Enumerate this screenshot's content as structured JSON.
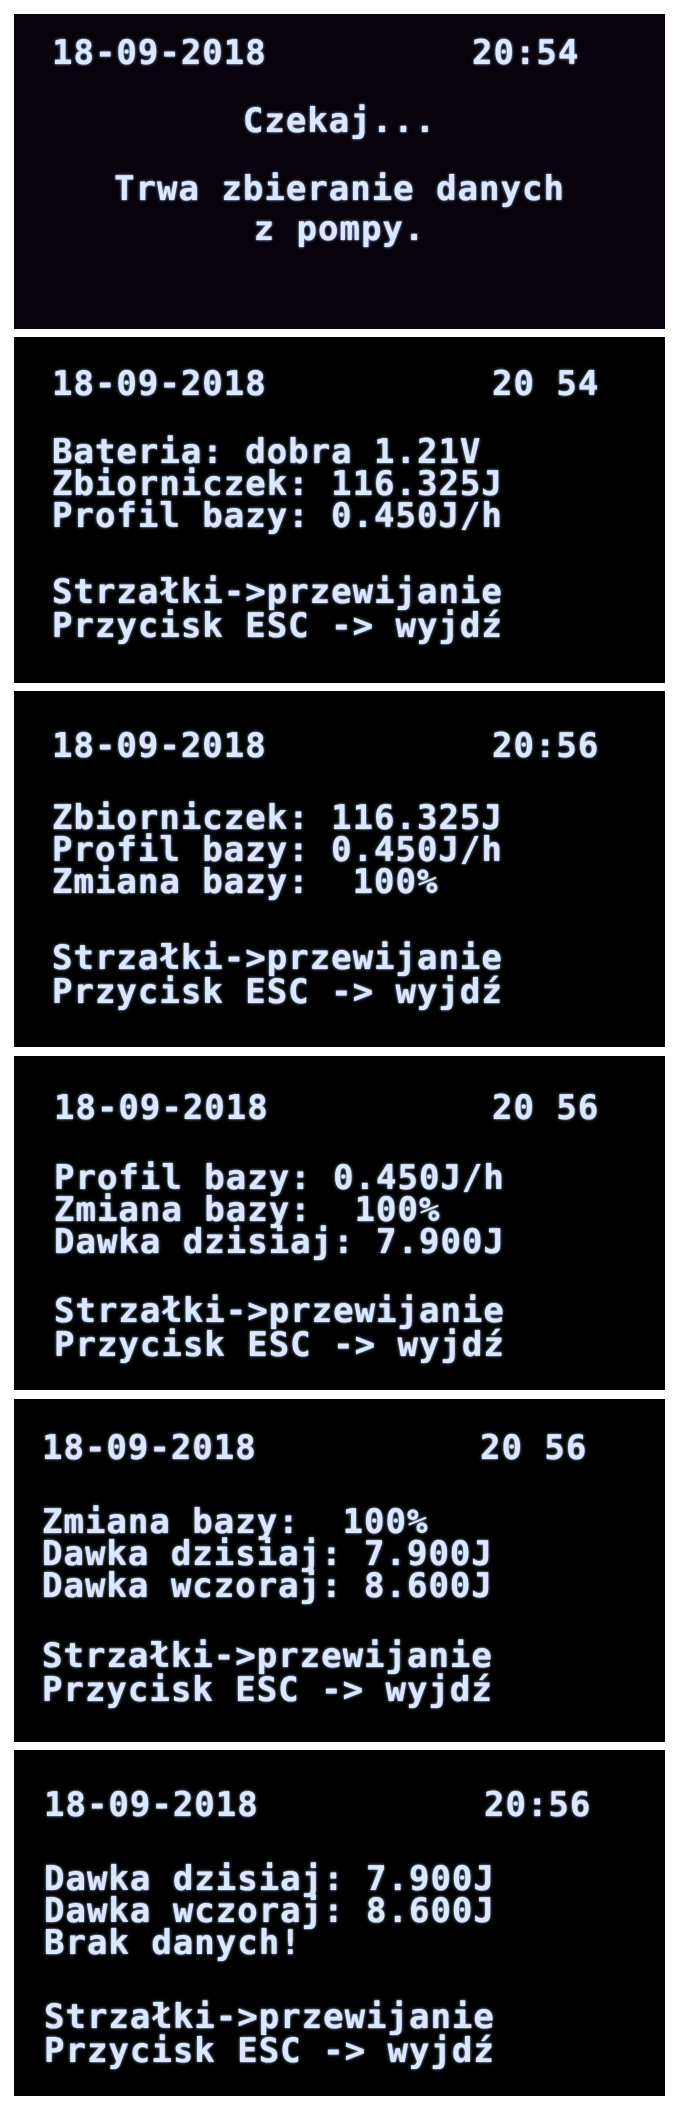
{
  "screens": [
    {
      "date": "18-09-2018",
      "time": "20:54",
      "lines": [
        "Czekaj...",
        "Trwa zbieranie danych",
        "z pompy."
      ]
    },
    {
      "date": "18-09-2018",
      "time": "20 54",
      "lines": [
        "Bateria: dobra 1.21V",
        "Zbiorniczek: 116.325J",
        "Profil bazy: 0.450J/h"
      ],
      "footer": [
        "Strzałki->przewijanie",
        "Przycisk ESC -> wyjdź"
      ]
    },
    {
      "date": "18-09-2018",
      "time": "20:56",
      "lines": [
        "Zbiorniczek: 116.325J",
        "Profil bazy: 0.450J/h",
        "Zmiana bazy:  100%"
      ],
      "footer": [
        "Strzałki->przewijanie",
        "Przycisk ESC -> wyjdź"
      ]
    },
    {
      "date": "18-09-2018",
      "time": "20 56",
      "lines": [
        "Profil bazy: 0.450J/h",
        "Zmiana bazy:  100%",
        "Dawka dzisiaj: 7.900J"
      ],
      "footer": [
        "Strzałki->przewijanie",
        "Przycisk ESC -> wyjdź"
      ]
    },
    {
      "date": "18-09-2018",
      "time": "20 56",
      "lines": [
        "Zmiana bazy:  100%",
        "Dawka dzisiaj: 7.900J",
        "Dawka wczoraj: 8.600J"
      ],
      "footer": [
        "Strzałki->przewijanie",
        "Przycisk ESC -> wyjdź"
      ]
    },
    {
      "date": "18-09-2018",
      "time": "20:56",
      "lines": [
        "Dawka dzisiaj: 7.900J",
        "Dawka wczoraj: 8.600J",
        "Brak danych!"
      ],
      "footer": [
        "Strzałki->przewijanie",
        "Przycisk ESC -> wyjdź"
      ]
    }
  ]
}
